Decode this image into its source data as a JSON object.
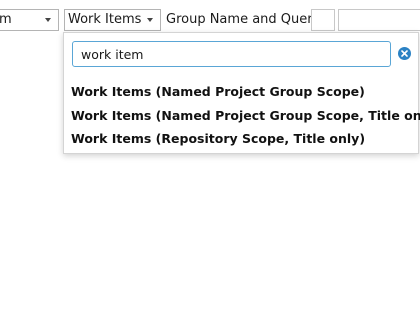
{
  "toolbar": {
    "left_combo_text": "m",
    "search_type_combo": {
      "selected": "Work Items"
    },
    "group_query_label": "Group Name and Query:"
  },
  "dropdown": {
    "filter_value": "work item",
    "results": [
      {
        "label": "Work Items (Named Project Group Scope)"
      },
      {
        "label": "Work Items (Named Project Group Scope, Title only)"
      },
      {
        "label": "Work Items (Repository Scope, Title only)"
      }
    ]
  },
  "icons": {
    "clear": "clear-search-icon",
    "chevron": "chevron-down-icon"
  },
  "colors": {
    "focus_border": "#5aa6d6",
    "clear_button": "#2b82c4"
  }
}
